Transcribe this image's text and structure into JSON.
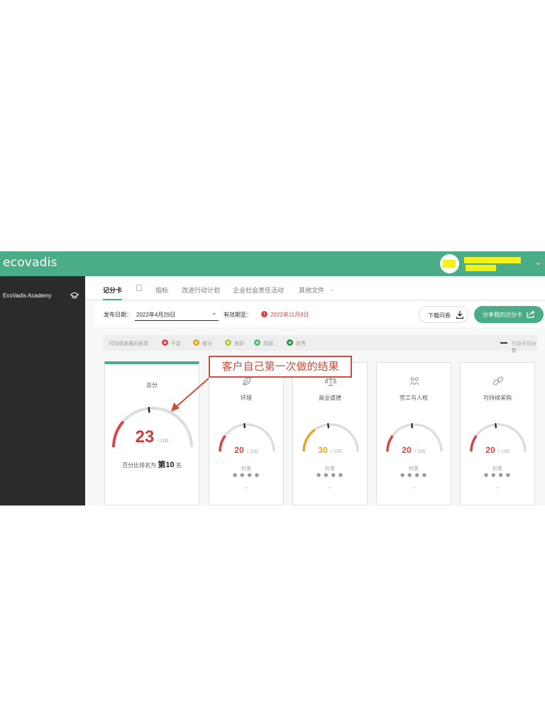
{
  "brand": "ecovadis",
  "sidebar": {
    "academy_label": "EcoVadis Academy"
  },
  "tabs": [
    {
      "label": "记分卡",
      "active": true
    },
    {
      "label": "指标",
      "active": false
    },
    {
      "label": "改进行动计划",
      "active": false
    },
    {
      "label": "企业社会责任活动",
      "active": false
    },
    {
      "label": "其他文件",
      "active": false
    }
  ],
  "filter": {
    "publish_label": "发布日期：",
    "publish_value": "2022年4月29日",
    "valid_label": "有效期至：",
    "valid_value": "2022年11月8日",
    "download_label": "下载问卷",
    "share_label": "分享我的记分卡"
  },
  "legend": {
    "intro": "可持续发展的表现",
    "items": [
      {
        "label": "不足",
        "color": "#d9464a"
      },
      {
        "label": "部分",
        "color": "#e5a52b"
      },
      {
        "label": "良好",
        "color": "#b6c932"
      },
      {
        "label": "高级",
        "color": "#5cba78"
      },
      {
        "label": "优秀",
        "color": "#2f8f45"
      }
    ],
    "industry_label": "行业平均分数"
  },
  "overall": {
    "title": "总分",
    "score": 23,
    "max_label": "/ 100",
    "rank_prefix": "百分比排名为",
    "rank_value": "第10",
    "rank_suffix": "名",
    "color": "#d9464a"
  },
  "themes": [
    {
      "title": "环境",
      "score": 20,
      "max_label": "/ 100",
      "weight_label": "权重",
      "weight_dots": "● ● ● ●",
      "color": "#d9464a",
      "icon": "leaf-icon"
    },
    {
      "title": "商业道德",
      "score": 30,
      "max_label": "/ 100",
      "weight_label": "权重",
      "weight_dots": "● ● ● ●",
      "color": "#e5a52b",
      "icon": "scales-icon"
    },
    {
      "title": "劳工与人权",
      "score": 20,
      "max_label": "/ 100",
      "weight_label": "权重",
      "weight_dots": "● ● ● ●",
      "color": "#d9464a",
      "icon": "people-icon"
    },
    {
      "title": "可持续采购",
      "score": 20,
      "max_label": "/ 100",
      "weight_label": "权重",
      "weight_dots": "● ● ● ●",
      "color": "#d9464a",
      "icon": "chain-icon"
    }
  ],
  "annotation": {
    "text": "客户自己第一次做的结果",
    "color": "#d24b3e"
  }
}
